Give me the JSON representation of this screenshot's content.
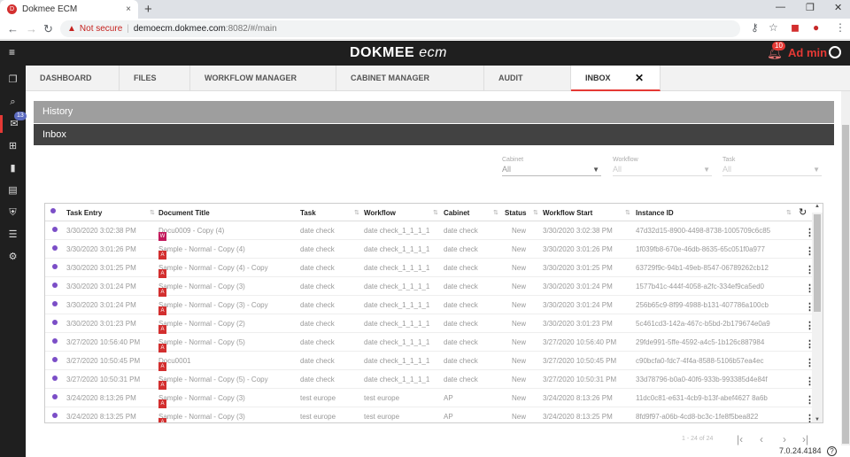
{
  "browser": {
    "tab_title": "Dokmee ECM",
    "tab_close": "×",
    "new_tab": "+",
    "window_controls": [
      "—",
      "❐",
      "✕"
    ],
    "not_secure": "Not secure",
    "url_host": "demoecm.dokmee.com",
    "url_path": ":8082/#/main"
  },
  "app": {
    "logo_main": "DOKMEE",
    "logo_sub": "ecm",
    "notif_count": "10",
    "user_name": "Ad min",
    "sidebar_badge": "13"
  },
  "nav": {
    "tabs": [
      {
        "label": "DASHBOARD"
      },
      {
        "label": "FILES"
      },
      {
        "label": "WORKFLOW MANAGER"
      },
      {
        "label": "CABINET MANAGER"
      },
      {
        "label": "AUDIT"
      },
      {
        "label": "INBOX"
      }
    ],
    "close": "✕"
  },
  "sections": {
    "history": "History",
    "inbox": "Inbox"
  },
  "filters": {
    "cabinet": {
      "label": "Cabinet",
      "value": "All"
    },
    "workflow": {
      "label": "Workflow",
      "value": "All"
    },
    "task": {
      "label": "Task",
      "value": "All"
    }
  },
  "grid": {
    "headers": [
      "Task Entry",
      "Document Title",
      "Task",
      "Workflow",
      "Cabinet",
      "Status",
      "Workflow Start",
      "Instance ID"
    ],
    "rows": [
      {
        "entry": "3/30/2020 3:02:38 PM",
        "title": "Docu0009 - Copy (4)",
        "type": "doc",
        "task": "date check",
        "workflow": "date check_1_1_1_1",
        "cabinet": "date check",
        "status": "New",
        "start": "3/30/2020 3:02:38 PM",
        "id": "47d32d15-8900-4498-8738-1005709c6c85"
      },
      {
        "entry": "3/30/2020 3:01:26 PM",
        "title": "Sample - Normal - Copy (4)",
        "type": "pdf",
        "task": "date check",
        "workflow": "date check_1_1_1_1",
        "cabinet": "date check",
        "status": "New",
        "start": "3/30/2020 3:01:26 PM",
        "id": "1f039fb8-670e-46db-8635-65c051f0a977"
      },
      {
        "entry": "3/30/2020 3:01:25 PM",
        "title": "Sample - Normal - Copy (4) - Copy",
        "type": "pdf",
        "task": "date check",
        "workflow": "date check_1_1_1_1",
        "cabinet": "date check",
        "status": "New",
        "start": "3/30/2020 3:01:25 PM",
        "id": "63729f9c-94b1-49eb-8547-06789262cb12"
      },
      {
        "entry": "3/30/2020 3:01:24 PM",
        "title": "Sample - Normal - Copy (3)",
        "type": "pdf",
        "task": "date check",
        "workflow": "date check_1_1_1_1",
        "cabinet": "date check",
        "status": "New",
        "start": "3/30/2020 3:01:24 PM",
        "id": "1577b41c-444f-4058-a2fc-334ef9ca5ed0"
      },
      {
        "entry": "3/30/2020 3:01:24 PM",
        "title": "Sample - Normal - Copy (3) - Copy",
        "type": "pdf",
        "task": "date check",
        "workflow": "date check_1_1_1_1",
        "cabinet": "date check",
        "status": "New",
        "start": "3/30/2020 3:01:24 PM",
        "id": "256b65c9-8f99-4988-b131-407786a100cb"
      },
      {
        "entry": "3/30/2020 3:01:23 PM",
        "title": "Sample - Normal - Copy (2)",
        "type": "pdf",
        "task": "date check",
        "workflow": "date check_1_1_1_1",
        "cabinet": "date check",
        "status": "New",
        "start": "3/30/2020 3:01:23 PM",
        "id": "5c461cd3-142a-467c-b5bd-2b179674e0a9"
      },
      {
        "entry": "3/27/2020 10:56:40 PM",
        "title": "Sample - Normal - Copy (5)",
        "type": "pdf",
        "task": "date check",
        "workflow": "date check_1_1_1_1",
        "cabinet": "date check",
        "status": "New",
        "start": "3/27/2020 10:56:40 PM",
        "id": "29fde991-5ffe-4592-a4c5-1b126c887984"
      },
      {
        "entry": "3/27/2020 10:50:45 PM",
        "title": "Docu0001",
        "type": "pdf",
        "task": "date check",
        "workflow": "date check_1_1_1_1",
        "cabinet": "date check",
        "status": "New",
        "start": "3/27/2020 10:50:45 PM",
        "id": "c90bcfa0-fdc7-4f4a-8588-5106b57ea4ec"
      },
      {
        "entry": "3/27/2020 10:50:31 PM",
        "title": "Sample - Normal - Copy (5) - Copy",
        "type": "pdf",
        "task": "date check",
        "workflow": "date check_1_1_1_1",
        "cabinet": "date check",
        "status": "New",
        "start": "3/27/2020 10:50:31 PM",
        "id": "33d78796-b0a0-40f6-933b-993385d4e84f"
      },
      {
        "entry": "3/24/2020 8:13:26 PM",
        "title": "Sample - Normal - Copy (3)",
        "type": "pdf",
        "task": "test europe",
        "workflow": "test europe",
        "cabinet": "AP",
        "status": "New",
        "start": "3/24/2020 8:13:26 PM",
        "id": "11dc0c81-e631-4cb9-b13f-abef4627 8a6b"
      },
      {
        "entry": "3/24/2020 8:13:25 PM",
        "title": "Sample - Normal - Copy (3)",
        "type": "pdf",
        "task": "test europe",
        "workflow": "test europe",
        "cabinet": "AP",
        "status": "New",
        "start": "3/24/2020 8:13:25 PM",
        "id": "8fd9f97-a06b-4cd8-bc3c-1fe8f5bea822"
      }
    ]
  },
  "pagination": {
    "info": "1 - 24 of 24",
    "first": "|‹",
    "prev": "‹",
    "next": "›",
    "last": "›|"
  },
  "footer": {
    "version": "7.0.24.4184",
    "help": "?"
  },
  "colors": {
    "accent": "#e53935",
    "dark": "#1f1f1f",
    "status_dot": "#7b4ec7"
  }
}
